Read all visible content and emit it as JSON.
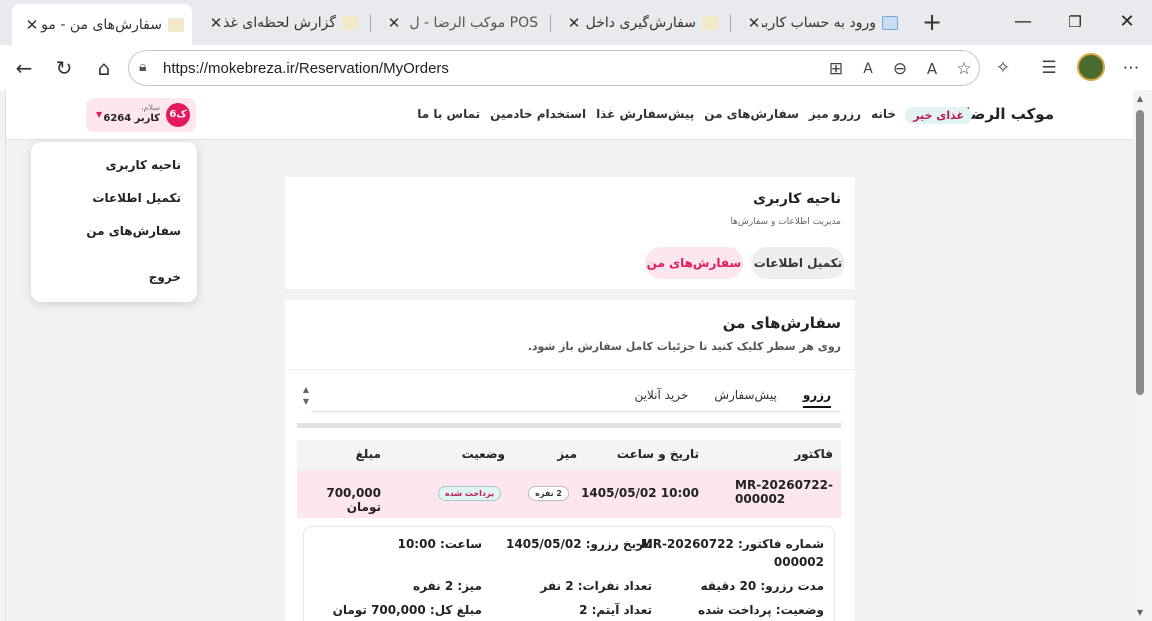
{
  "browser": {
    "tabs": [
      {
        "title": "سفارش‌های من - مو",
        "active": true
      },
      {
        "title": "گزارش لحظه‌ای غذا -",
        "active": false
      },
      {
        "title": "POS موکب الرضا - ل",
        "active": false
      },
      {
        "title": "سفارش‌گیری داخل سا",
        "active": false
      },
      {
        "title": "ورود به حساب کاربری",
        "active": false
      }
    ],
    "url": "https://mokebreza.ir/Reservation/MyOrders"
  },
  "site": {
    "brand": "موکب الرضا",
    "badge": "غذای خیر",
    "menu": [
      "خانه",
      "رزرو میز",
      "سفارش‌های من",
      "پیش‌سفارش غذا",
      "استخدام خادمین",
      "تماس با ما"
    ],
    "user": {
      "avatar": "ک6",
      "greeting": "سلام،",
      "name": "کاربر 6264"
    }
  },
  "dropdown": {
    "items": [
      "ناحیه کاربری",
      "تکمیل اطلاعات",
      "سفارش‌های من",
      "خروج"
    ]
  },
  "user_area": {
    "title": "ناحیه کاربری",
    "subtitle": "مدیریت اطلاعات و سفارش‌ها",
    "buttons": [
      "تکمیل اطلاعات",
      "سفارش‌های من"
    ]
  },
  "orders": {
    "title": "سفارش‌های من",
    "subtitle": "روی هر سطر کلیک کنید تا جزئیات کامل سفارش باز شود.",
    "tabs": [
      "رزرو",
      "پیش‌سفارش",
      "خرید آنلاین"
    ],
    "columns": [
      "فاکتور",
      "تاریخ و ساعت",
      "میز",
      "وضعیت",
      "مبلغ"
    ],
    "row": {
      "invoice_line1": "MR-20260722-",
      "invoice_line2": "000002",
      "datetime": "1405/05/02 10:00",
      "table": "2 نفره",
      "status": "پرداخت شده",
      "amount": "700,000 تومان"
    },
    "detail": {
      "invoice_label": "شماره فاکتور: MR-20260722-",
      "invoice_cont": "000002",
      "date": "تاریخ رزرو: 1405/05/02",
      "time": "ساعت: 10:00",
      "duration": "مدت رزرو: 20 دقیقه",
      "guests": "تعداد نفرات: 2 نفر",
      "table": "میز: 2 نفره",
      "status": "وضعیت: پرداخت شده",
      "items": "تعداد آیتم: 2",
      "total": "مبلغ کل: 700,000 تومان"
    }
  },
  "colors": {
    "accent": "#e6195e",
    "pink_bg": "#fde6ee",
    "mint_bg": "#e0f4f1"
  }
}
